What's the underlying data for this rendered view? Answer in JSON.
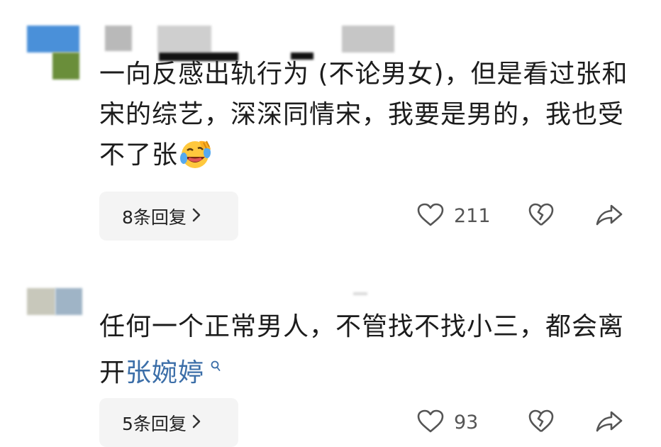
{
  "comments": [
    {
      "text": "一向反感出轨行为 (不论男女)，但是看过张和宋的综艺，深深同情宋，我要是男的，我也受不了张",
      "emoji": "laughing-crying-emoji",
      "replies_label": "8条回复",
      "like_count": "211"
    },
    {
      "text_before_link": "任何一个正常男人，不管找不找小三，都会离开",
      "link_text": "张婉婷",
      "replies_label": "5条回复",
      "like_count": "93"
    }
  ],
  "icons": {
    "like": "heart-icon",
    "dislike": "broken-heart-icon",
    "share": "share-arrow-icon",
    "chevron": "chevron-right-icon",
    "search": "search-icon"
  },
  "colors": {
    "link": "#3b6ea8",
    "reply_bg": "#f4f4f4",
    "text": "#1c1c1c"
  }
}
